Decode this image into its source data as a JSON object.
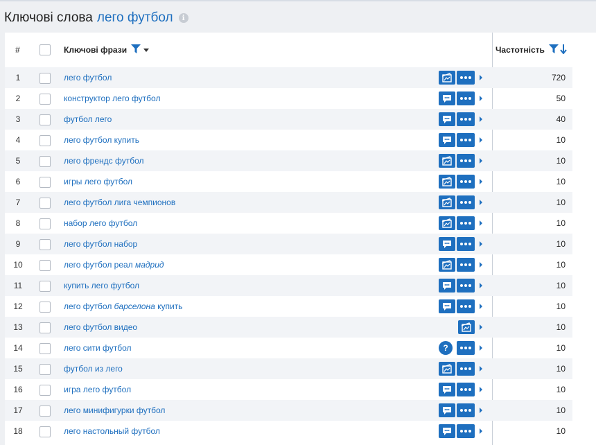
{
  "page": {
    "title_lead": "Ключові слова",
    "title_keyword": "лего футбол",
    "info_icon": "i"
  },
  "table": {
    "col_num": "#",
    "col_phrases": "Ключові фрази",
    "col_frequency": "Частотність",
    "colors": {
      "accent": "#1e6fbf",
      "stripe": "#f2f4f7"
    },
    "rows": [
      {
        "n": "1",
        "parts": [
          "лего футбол"
        ],
        "icon": "serp-icon",
        "freq": "720"
      },
      {
        "n": "2",
        "parts": [
          "конструктор лего футбол"
        ],
        "icon": "comment-icon",
        "freq": "50"
      },
      {
        "n": "3",
        "parts": [
          "футбол лего"
        ],
        "icon": "comment-icon",
        "freq": "40"
      },
      {
        "n": "4",
        "parts": [
          "лего футбол купить"
        ],
        "icon": "comment-icon",
        "freq": "10"
      },
      {
        "n": "5",
        "parts": [
          "лего френдс футбол"
        ],
        "icon": "serp-icon",
        "freq": "10"
      },
      {
        "n": "6",
        "parts": [
          "игры лего футбол"
        ],
        "icon": "serp-icon",
        "freq": "10"
      },
      {
        "n": "7",
        "parts": [
          "лего футбол лига чемпионов"
        ],
        "icon": "serp-icon",
        "freq": "10"
      },
      {
        "n": "8",
        "parts": [
          "набор лего футбол"
        ],
        "icon": "serp-icon",
        "freq": "10"
      },
      {
        "n": "9",
        "parts": [
          "лего футбол набор"
        ],
        "icon": "comment-icon",
        "freq": "10"
      },
      {
        "n": "10",
        "parts": [
          "лего футбол реал ",
          "мадрид"
        ],
        "italic_index": 1,
        "icon": "serp-icon",
        "freq": "10"
      },
      {
        "n": "11",
        "parts": [
          "купить лего футбол"
        ],
        "icon": "comment-icon",
        "freq": "10"
      },
      {
        "n": "12",
        "parts": [
          "лего футбол ",
          "барселона",
          " купить"
        ],
        "italic_index": 1,
        "icon": "comment-icon",
        "freq": "10"
      },
      {
        "n": "13",
        "parts": [
          "лего футбол видео"
        ],
        "icon": "serp-icon",
        "no_dots": true,
        "freq": "10"
      },
      {
        "n": "14",
        "parts": [
          "лего сити футбол"
        ],
        "icon": "help-icon",
        "help_text": "?",
        "freq": "10"
      },
      {
        "n": "15",
        "parts": [
          "футбол из лего"
        ],
        "icon": "serp-icon",
        "freq": "10"
      },
      {
        "n": "16",
        "parts": [
          "игра лего футбол"
        ],
        "icon": "comment-icon",
        "freq": "10"
      },
      {
        "n": "17",
        "parts": [
          "лего минифигурки футбол"
        ],
        "icon": "comment-icon",
        "freq": "10"
      },
      {
        "n": "18",
        "parts": [
          "лего настольный футбол"
        ],
        "icon": "comment-icon",
        "freq": "10"
      }
    ]
  }
}
